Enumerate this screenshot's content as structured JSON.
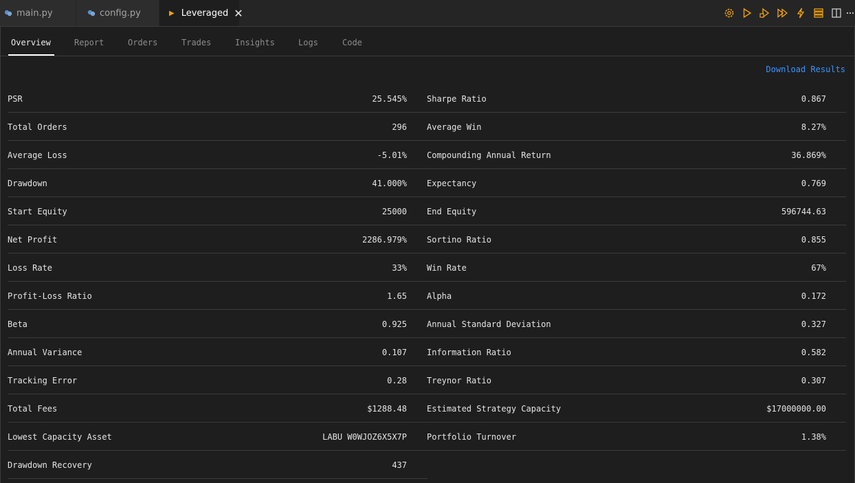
{
  "editor_tabs": [
    {
      "label": "main.py"
    },
    {
      "label": "config.py"
    },
    {
      "label": "Leveraged"
    }
  ],
  "colors": {
    "accent": "#f0a30a",
    "link": "#3794ff",
    "python_icon": "#5b8ec6"
  },
  "toolbar_icons": [
    "settings-icon",
    "run-icon",
    "debug-run-icon",
    "run-all-icon",
    "lightning-icon",
    "list-icon",
    "split-editor-icon",
    "more-icon"
  ],
  "subtabs": [
    "Overview",
    "Report",
    "Orders",
    "Trades",
    "Insights",
    "Logs",
    "Code"
  ],
  "active_subtab": "Overview",
  "download_label": "Download Results",
  "stats_left": [
    {
      "label": "PSR",
      "value": "25.545%"
    },
    {
      "label": "Total Orders",
      "value": "296"
    },
    {
      "label": "Average Loss",
      "value": "-5.01%"
    },
    {
      "label": "Drawdown",
      "value": "41.000%"
    },
    {
      "label": "Start Equity",
      "value": "25000"
    },
    {
      "label": "Net Profit",
      "value": "2286.979%"
    },
    {
      "label": "Loss Rate",
      "value": "33%"
    },
    {
      "label": "Profit-Loss Ratio",
      "value": "1.65"
    },
    {
      "label": "Beta",
      "value": "0.925"
    },
    {
      "label": "Annual Variance",
      "value": "0.107"
    },
    {
      "label": "Tracking Error",
      "value": "0.28"
    },
    {
      "label": "Total Fees",
      "value": "$1288.48"
    },
    {
      "label": "Lowest Capacity Asset",
      "value": "LABU W0WJOZ6X5X7P"
    },
    {
      "label": "Drawdown Recovery",
      "value": "437"
    }
  ],
  "stats_right": [
    {
      "label": "Sharpe Ratio",
      "value": "0.867"
    },
    {
      "label": "Average Win",
      "value": "8.27%"
    },
    {
      "label": "Compounding Annual Return",
      "value": "36.869%"
    },
    {
      "label": "Expectancy",
      "value": "0.769"
    },
    {
      "label": "End Equity",
      "value": "596744.63"
    },
    {
      "label": "Sortino Ratio",
      "value": "0.855"
    },
    {
      "label": "Win Rate",
      "value": "67%"
    },
    {
      "label": "Alpha",
      "value": "0.172"
    },
    {
      "label": "Annual Standard Deviation",
      "value": "0.327"
    },
    {
      "label": "Information Ratio",
      "value": "0.582"
    },
    {
      "label": "Treynor Ratio",
      "value": "0.307"
    },
    {
      "label": "Estimated Strategy Capacity",
      "value": "$17000000.00"
    },
    {
      "label": "Portfolio Turnover",
      "value": "1.38%"
    }
  ]
}
